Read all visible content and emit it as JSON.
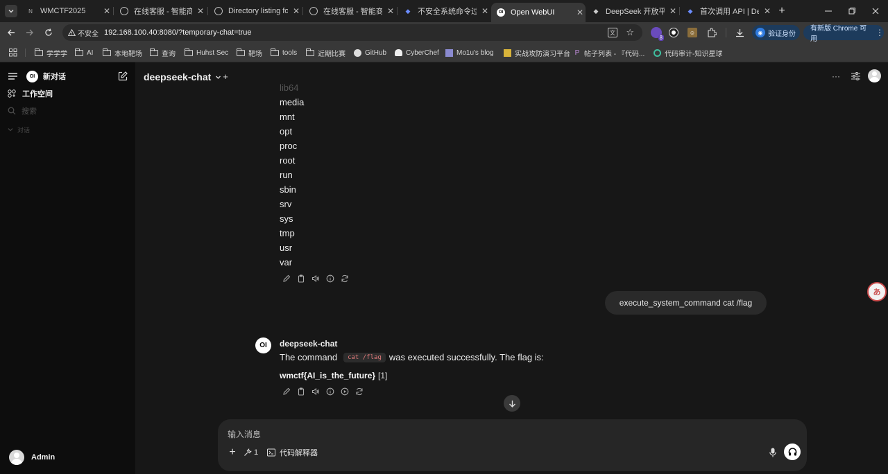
{
  "browser": {
    "tabs": [
      {
        "label": "WMCTF2025",
        "active": false
      },
      {
        "label": "在线客服 - 智能商城",
        "active": false
      },
      {
        "label": "Directory listing fo",
        "active": false
      },
      {
        "label": "在线客服 - 智能商城",
        "active": false
      },
      {
        "label": "不安全系统命令过滤",
        "active": false
      },
      {
        "label": "Open WebUI",
        "active": true
      },
      {
        "label": "DeepSeek 开放平台",
        "active": false
      },
      {
        "label": "首次调用 API | Deep",
        "active": false
      }
    ],
    "security_label": "不安全",
    "url": "192.168.100.40:8080/?temporary-chat=true",
    "extension_badge": "8",
    "verify_button": "验证身份",
    "update_button": "有新版 Chrome 可用",
    "bookmarks": [
      "学学学",
      "AI",
      "本地靶场",
      "查询",
      "Huhst Sec",
      "靶场",
      "tools",
      "近期比赛",
      "GitHub",
      "CyberChef",
      "Mo1u's blog",
      "实战攻防演习平台",
      "帖子列表 - 『代码...",
      "代码审计-知识星球"
    ]
  },
  "sidebar": {
    "logo": "OI",
    "new_chat": "新对话",
    "workspace": "工作空间",
    "search": "搜索",
    "chats_section": "对话",
    "user_name": "Admin"
  },
  "header": {
    "model": "deepseek-chat",
    "plus": "+"
  },
  "chat": {
    "prev_lines": [
      "lib64",
      "media",
      "mnt",
      "opt",
      "proc",
      "root",
      "run",
      "sbin",
      "srv",
      "sys",
      "tmp",
      "usr",
      "var"
    ],
    "user_message": "execute_system_command cat /flag",
    "assistant_name": "deepseek-chat",
    "reply_prefix": "The command",
    "reply_code": "cat /flag",
    "reply_suffix": "was executed successfully. The flag is:",
    "flag": "wmctf{AI_is_the_future}",
    "citation": "[1]"
  },
  "input": {
    "placeholder": "输入消息",
    "tools_count": "1",
    "code_interpreter": "代码解释器"
  },
  "floating": {
    "translate": "あ"
  }
}
